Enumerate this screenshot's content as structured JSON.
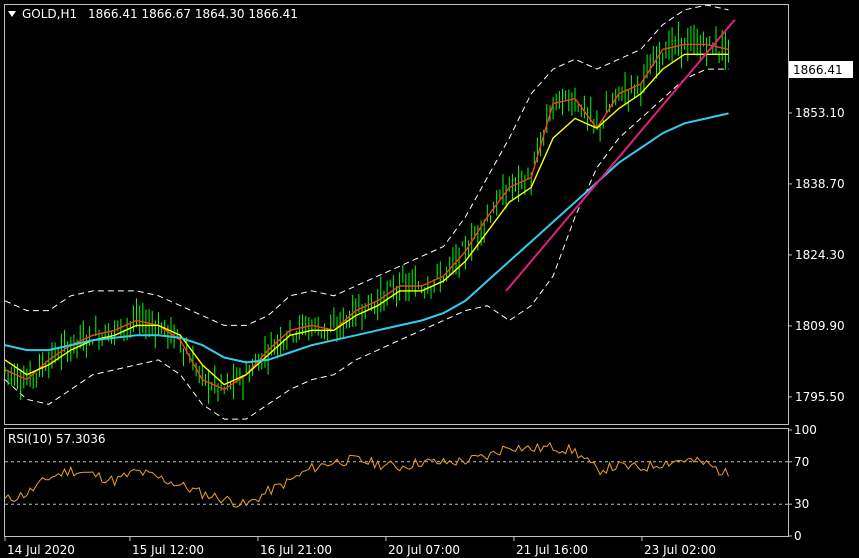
{
  "header": {
    "symbol": "GOLD,H1",
    "ohlc": "1866.41 1866.67 1864.30 1866.41"
  },
  "price_badge": "1866.41",
  "rsi_label": "RSI(10) 57.3036",
  "colors": {
    "background": "#000000",
    "frame": "#c0c0c0",
    "candle": "#00ff00",
    "price_axis_text": "#ffffff",
    "ma_fast": "#ff3b1f",
    "ma_mid": "#ffff00",
    "ma_slow": "#33ccee",
    "bands": "#ffffff",
    "trendline": "#e0207a",
    "rsi_line": "#f0a020",
    "rsi_levels": "#c0c0c0"
  },
  "chart_data": [
    {
      "type": "line",
      "title": "GOLD,H1",
      "ylabel": "",
      "y_ticks": [
        "1866.41",
        "1853.10",
        "1838.70",
        "1824.30",
        "1809.90",
        "1795.50"
      ],
      "x_ticks": [
        "14 Jul 2020",
        "15 Jul 12:00",
        "16 Jul 21:00",
        "20 Jul 07:00",
        "21 Jul 16:00",
        "23 Jul 02:00"
      ],
      "ylim": [
        1790,
        1875
      ],
      "last_price": 1866.41,
      "x_index": [
        0,
        7,
        14,
        21,
        28,
        35,
        42,
        49,
        56,
        63,
        70,
        77,
        84,
        91,
        98,
        105,
        112,
        119,
        126,
        133,
        140,
        147,
        154,
        161,
        168,
        175,
        182,
        189,
        196,
        203,
        210,
        217,
        224,
        231
      ],
      "series": [
        {
          "values": [
            1801,
            1799,
            1803,
            1806,
            1808,
            1809,
            1811,
            1810,
            1807,
            1799,
            1797,
            1800,
            1805,
            1809,
            1810,
            1809,
            1813,
            1815,
            1818,
            1818,
            1820,
            1825,
            1832,
            1838,
            1840,
            1855,
            1856,
            1850,
            1857,
            1859,
            1866,
            1867,
            1867,
            1866
          ]
        },
        {
          "values": [
            1803,
            1800,
            1802,
            1805,
            1807,
            1808,
            1810,
            1810,
            1808,
            1802,
            1798,
            1800,
            1804,
            1808,
            1809,
            1809,
            1812,
            1814,
            1817,
            1817,
            1819,
            1823,
            1829,
            1835,
            1838,
            1848,
            1852,
            1850,
            1854,
            1857,
            1862,
            1865,
            1865,
            1865
          ]
        },
        {
          "values": [
            1806,
            1805,
            1805,
            1806,
            1807,
            1807.5,
            1808,
            1808,
            1807.5,
            1806,
            1803.5,
            1802.5,
            1803,
            1804.5,
            1806,
            1807,
            1808,
            1809,
            1810,
            1811,
            1812.5,
            1815,
            1819,
            1823,
            1827,
            1831,
            1835,
            1839,
            1843,
            1846,
            1849,
            1851,
            1852,
            1853
          ]
        }
      ],
      "upper_band": [
        1815,
        1813,
        1813,
        1816,
        1817,
        1817,
        1817,
        1816,
        1814,
        1812,
        1810,
        1810,
        1812,
        1816,
        1817,
        1816,
        1818,
        1820,
        1822,
        1824,
        1826,
        1832,
        1840,
        1848,
        1857,
        1862,
        1864,
        1862,
        1864,
        1866,
        1871,
        1874,
        1875,
        1874
      ],
      "lower_band": [
        1799,
        1795,
        1794,
        1797,
        1800,
        1801,
        1802,
        1803,
        1800,
        1794,
        1791,
        1791,
        1794,
        1797,
        1799,
        1800,
        1803,
        1805,
        1807,
        1809,
        1811,
        1813,
        1814,
        1811,
        1814,
        1820,
        1832,
        1842,
        1848,
        1852,
        1856,
        1860,
        1862,
        1862
      ],
      "trendline": {
        "from": {
          "x": 160,
          "y": 1817
        },
        "to": {
          "x": 233,
          "y": 1872
        }
      }
    },
    {
      "type": "line",
      "title": "RSI(10) 57.3036",
      "y_ticks": [
        "100",
        "70",
        "30",
        "0"
      ],
      "ylim": [
        0,
        100
      ],
      "levels": [
        70,
        30
      ],
      "last_value": 57.3036,
      "x_index": [
        0,
        7,
        14,
        21,
        28,
        35,
        42,
        49,
        56,
        63,
        70,
        77,
        84,
        91,
        98,
        105,
        112,
        119,
        126,
        133,
        140,
        147,
        154,
        161,
        168,
        175,
        182,
        189,
        196,
        203,
        210,
        217,
        224,
        231
      ],
      "values": [
        34,
        40,
        55,
        62,
        58,
        52,
        61,
        55,
        48,
        40,
        35,
        29,
        42,
        52,
        64,
        70,
        72,
        68,
        65,
        70,
        69,
        71,
        75,
        85,
        82,
        84,
        80,
        62,
        66,
        64,
        69,
        72,
        68,
        57.3
      ]
    }
  ]
}
